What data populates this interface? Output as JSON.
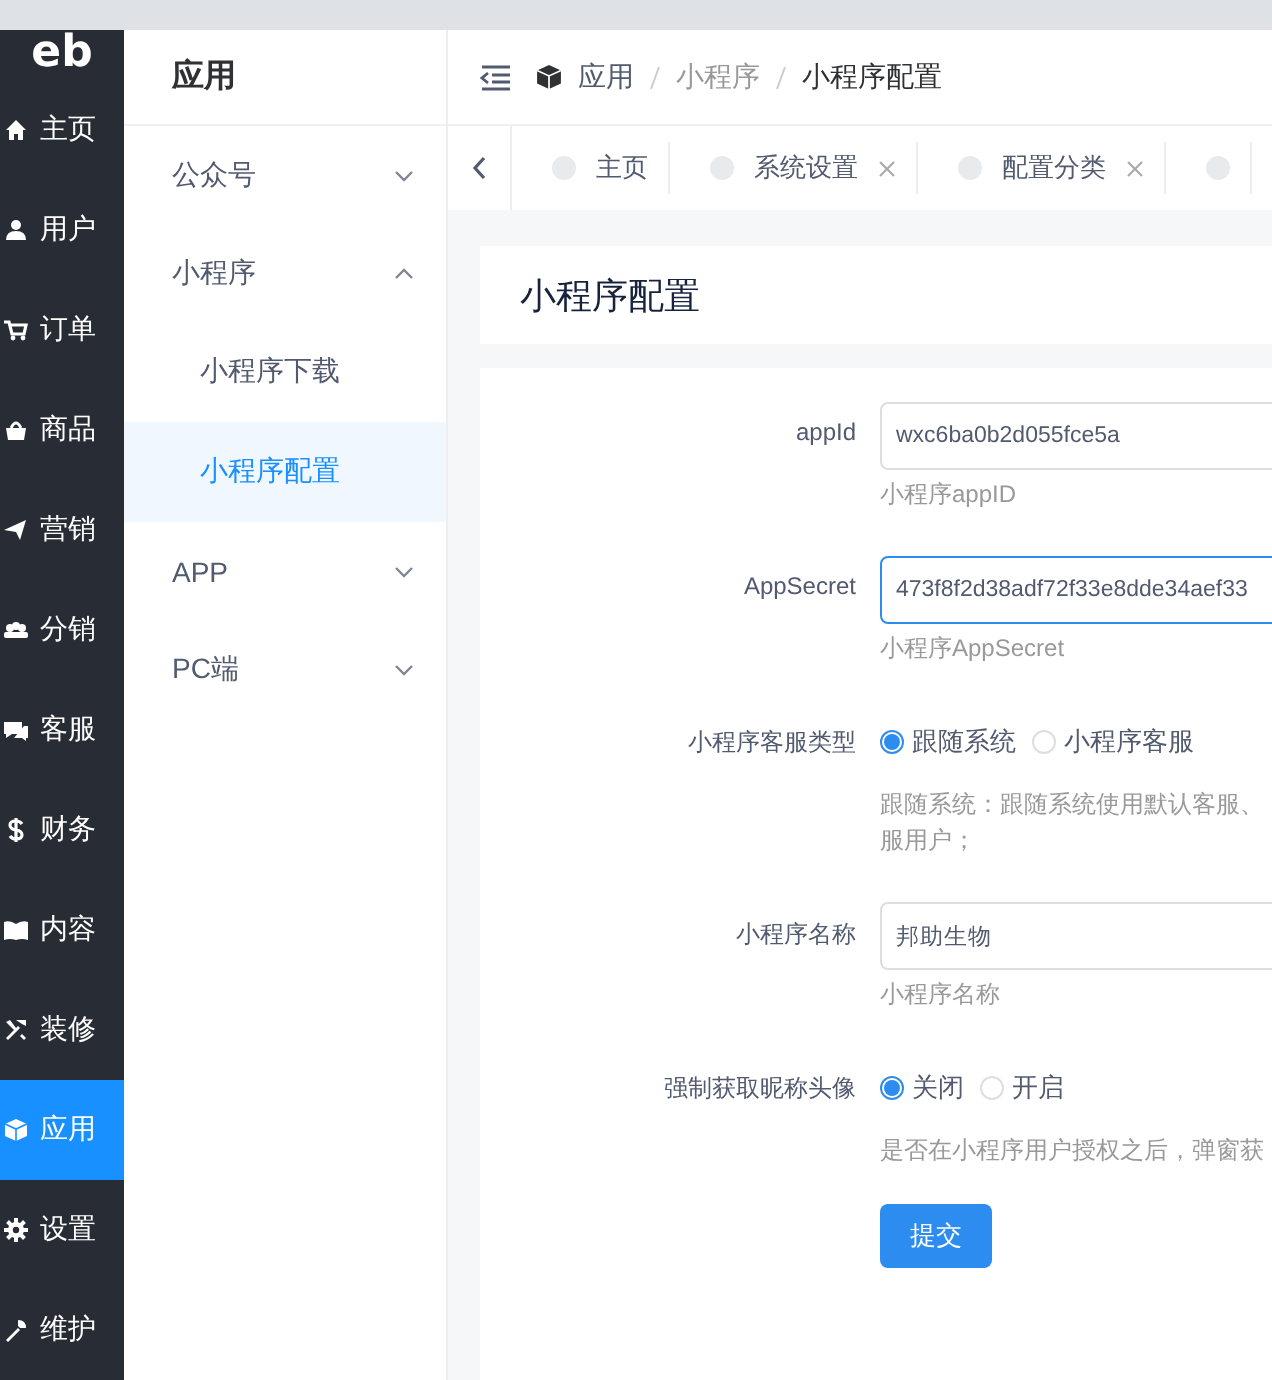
{
  "logo": "eb",
  "rail": [
    {
      "label": "主页",
      "selected": false
    },
    {
      "label": "用户",
      "selected": false
    },
    {
      "label": "订单",
      "selected": false
    },
    {
      "label": "商品",
      "selected": false
    },
    {
      "label": "营销",
      "selected": false
    },
    {
      "label": "分销",
      "selected": false
    },
    {
      "label": "客服",
      "selected": false
    },
    {
      "label": "财务",
      "selected": false
    },
    {
      "label": "内容",
      "selected": false
    },
    {
      "label": "装修",
      "selected": false
    },
    {
      "label": "应用",
      "selected": true
    },
    {
      "label": "设置",
      "selected": false
    },
    {
      "label": "维护",
      "selected": false
    }
  ],
  "submenu": {
    "title": "应用",
    "items": [
      {
        "label": "公众号",
        "expanded": false
      },
      {
        "label": "小程序",
        "expanded": true,
        "children": [
          {
            "label": "小程序下载",
            "selected": false
          },
          {
            "label": "小程序配置",
            "selected": true
          }
        ]
      },
      {
        "label": "APP",
        "expanded": false
      },
      {
        "label": "PC端",
        "expanded": false
      }
    ]
  },
  "breadcrumb": [
    "应用",
    "小程序",
    "小程序配置"
  ],
  "tabs": [
    {
      "label": "主页",
      "closable": false
    },
    {
      "label": "系统设置",
      "closable": true
    },
    {
      "label": "配置分类",
      "closable": true
    },
    {
      "closable": false
    }
  ],
  "page_title": "小程序配置",
  "form": [
    {
      "kind": "input",
      "label": "appId",
      "value": "wxc6ba0b2d055fce5a",
      "focused": false,
      "hint": [
        "小程序appID"
      ]
    },
    {
      "kind": "input",
      "label": "AppSecret",
      "value": "473f8f2d38adf72f33e8dde34aef33",
      "focused": true,
      "hint": [
        "小程序AppSecret"
      ]
    },
    {
      "kind": "radio",
      "label": "小程序客服类型",
      "options": [
        {
          "label": "跟随系统",
          "selected": true
        },
        {
          "label": "小程序客服",
          "selected": false
        }
      ],
      "hint": [
        "跟随系统：跟随系统使用默认客服、",
        "服用户；"
      ]
    },
    {
      "kind": "input",
      "label": "小程序名称",
      "value": "邦助生物",
      "focused": false,
      "hint": [
        "小程序名称"
      ]
    },
    {
      "kind": "radio",
      "label": "强制获取昵称头像",
      "options": [
        {
          "label": "关闭",
          "selected": true
        },
        {
          "label": "开启",
          "selected": false
        }
      ],
      "hint": [
        "是否在小程序用户授权之后，弹窗获"
      ]
    }
  ],
  "submit": "提交"
}
